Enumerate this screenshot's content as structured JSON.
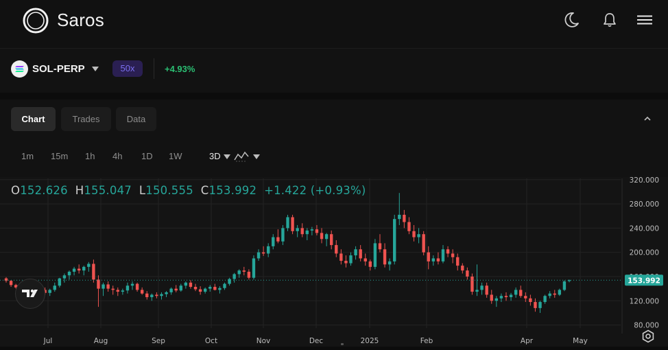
{
  "header": {
    "brand": "Saros",
    "icons": [
      "theme-moon-icon",
      "notification-bell-icon",
      "menu-icon"
    ]
  },
  "market": {
    "symbol": "SOL-PERP",
    "leverage": "50x",
    "change": "+4.93%"
  },
  "tabs": [
    {
      "label": "Chart",
      "active": true
    },
    {
      "label": "Trades",
      "active": false
    },
    {
      "label": "Data",
      "active": false
    }
  ],
  "intervals": [
    "1m",
    "15m",
    "1h",
    "4h",
    "1D",
    "1W"
  ],
  "interval_selected": "3D",
  "ohlc": {
    "o_label": "O",
    "o": "152.626",
    "h_label": "H",
    "h": "155.047",
    "l_label": "L",
    "l": "150.555",
    "c_label": "C",
    "c": "153.992",
    "change": "+1.422 (+0.93%)"
  },
  "chart_data": {
    "type": "candlestick",
    "x_ticks": [
      "Jul",
      "Aug",
      "Sep",
      "Oct",
      "Nov",
      "Dec",
      "2025",
      "Feb",
      "Apr",
      "May"
    ],
    "y_ticks": [
      "320.000",
      "280.000",
      "240.000",
      "200.000",
      "160.000",
      "120.000",
      "80.000"
    ],
    "ylim": [
      75,
      322
    ],
    "last_price": "153.992",
    "colors": {
      "up": "#26a69a",
      "down": "#ef5350",
      "background": "#141414",
      "grid": "#232323"
    },
    "candles": [
      [
        157,
        159,
        150,
        153
      ],
      [
        153,
        154,
        143,
        146
      ],
      [
        146,
        148,
        140,
        142
      ],
      [
        142,
        143,
        138,
        139
      ],
      [
        139,
        142,
        136,
        141
      ],
      [
        141,
        150,
        137,
        148
      ],
      [
        148,
        149,
        128,
        135
      ],
      [
        135,
        140,
        125,
        138
      ],
      [
        138,
        142,
        130,
        133
      ],
      [
        133,
        140,
        128,
        138
      ],
      [
        138,
        150,
        135,
        145
      ],
      [
        145,
        158,
        142,
        157
      ],
      [
        157,
        165,
        150,
        162
      ],
      [
        162,
        170,
        155,
        168
      ],
      [
        168,
        176,
        162,
        173
      ],
      [
        173,
        180,
        165,
        170
      ],
      [
        170,
        178,
        162,
        176
      ],
      [
        176,
        184,
        168,
        181
      ],
      [
        181,
        188,
        150,
        155
      ],
      [
        155,
        162,
        110,
        140
      ],
      [
        140,
        150,
        128,
        147
      ],
      [
        147,
        152,
        135,
        140
      ],
      [
        140,
        145,
        130,
        138
      ],
      [
        138,
        142,
        128,
        135
      ],
      [
        135,
        140,
        130,
        137
      ],
      [
        137,
        150,
        132,
        145
      ],
      [
        145,
        152,
        138,
        148
      ],
      [
        148,
        150,
        135,
        138
      ],
      [
        138,
        142,
        130,
        132
      ],
      [
        132,
        136,
        122,
        126
      ],
      [
        126,
        132,
        120,
        130
      ],
      [
        130,
        134,
        124,
        128
      ],
      [
        128,
        134,
        122,
        131
      ],
      [
        131,
        136,
        126,
        134
      ],
      [
        134,
        142,
        130,
        140
      ],
      [
        140,
        146,
        134,
        137
      ],
      [
        137,
        148,
        135,
        145
      ],
      [
        145,
        152,
        140,
        150
      ],
      [
        150,
        154,
        140,
        143
      ],
      [
        143,
        148,
        136,
        139
      ],
      [
        139,
        144,
        130,
        135
      ],
      [
        135,
        142,
        132,
        140
      ],
      [
        140,
        146,
        135,
        143
      ],
      [
        143,
        148,
        137,
        138
      ],
      [
        138,
        144,
        132,
        141
      ],
      [
        141,
        150,
        138,
        148
      ],
      [
        148,
        158,
        145,
        156
      ],
      [
        156,
        166,
        150,
        164
      ],
      [
        164,
        172,
        158,
        170
      ],
      [
        170,
        176,
        162,
        168
      ],
      [
        168,
        172,
        155,
        158
      ],
      [
        158,
        195,
        155,
        190
      ],
      [
        190,
        205,
        186,
        200
      ],
      [
        200,
        210,
        194,
        198
      ],
      [
        198,
        215,
        192,
        210
      ],
      [
        210,
        230,
        205,
        225
      ],
      [
        225,
        238,
        215,
        218
      ],
      [
        218,
        245,
        212,
        240
      ],
      [
        240,
        262,
        235,
        258
      ],
      [
        258,
        262,
        230,
        235
      ],
      [
        235,
        245,
        225,
        240
      ],
      [
        240,
        248,
        225,
        230
      ],
      [
        230,
        240,
        220,
        236
      ],
      [
        236,
        242,
        228,
        238
      ],
      [
        238,
        245,
        228,
        232
      ],
      [
        232,
        240,
        215,
        222
      ],
      [
        222,
        232,
        210,
        230
      ],
      [
        230,
        236,
        205,
        212
      ],
      [
        212,
        220,
        192,
        198
      ],
      [
        198,
        205,
        180,
        186
      ],
      [
        186,
        195,
        175,
        182
      ],
      [
        182,
        200,
        178,
        195
      ],
      [
        195,
        210,
        188,
        205
      ],
      [
        205,
        212,
        185,
        190
      ],
      [
        190,
        198,
        178,
        185
      ],
      [
        185,
        188,
        170,
        176
      ],
      [
        176,
        222,
        172,
        215
      ],
      [
        215,
        230,
        200,
        205
      ],
      [
        205,
        215,
        175,
        180
      ],
      [
        180,
        190,
        170,
        185
      ],
      [
        185,
        262,
        180,
        255
      ],
      [
        255,
        298,
        245,
        262
      ],
      [
        262,
        270,
        240,
        250
      ],
      [
        250,
        258,
        230,
        235
      ],
      [
        235,
        245,
        218,
        225
      ],
      [
        225,
        240,
        215,
        230
      ],
      [
        230,
        235,
        195,
        200
      ],
      [
        200,
        210,
        172,
        185
      ],
      [
        185,
        195,
        178,
        190
      ],
      [
        190,
        200,
        180,
        185
      ],
      [
        185,
        212,
        182,
        205
      ],
      [
        205,
        210,
        192,
        198
      ],
      [
        198,
        205,
        182,
        192
      ],
      [
        192,
        198,
        170,
        178
      ],
      [
        178,
        182,
        165,
        170
      ],
      [
        170,
        175,
        155,
        160
      ],
      [
        160,
        165,
        130,
        135
      ],
      [
        135,
        180,
        128,
        138
      ],
      [
        138,
        150,
        130,
        145
      ],
      [
        145,
        150,
        125,
        130
      ],
      [
        130,
        138,
        115,
        120
      ],
      [
        120,
        128,
        110,
        124
      ],
      [
        124,
        132,
        118,
        128
      ],
      [
        128,
        134,
        120,
        126
      ],
      [
        126,
        133,
        120,
        130
      ],
      [
        130,
        142,
        125,
        138
      ],
      [
        138,
        145,
        125,
        128
      ],
      [
        128,
        134,
        118,
        124
      ],
      [
        124,
        130,
        112,
        118
      ],
      [
        118,
        124,
        102,
        108
      ],
      [
        108,
        120,
        100,
        118
      ],
      [
        118,
        130,
        115,
        128
      ],
      [
        128,
        136,
        124,
        132
      ],
      [
        132,
        138,
        125,
        130
      ],
      [
        130,
        140,
        128,
        138
      ],
      [
        138,
        154,
        136,
        152
      ],
      [
        152.626,
        155.047,
        150.555,
        153.992
      ]
    ]
  }
}
